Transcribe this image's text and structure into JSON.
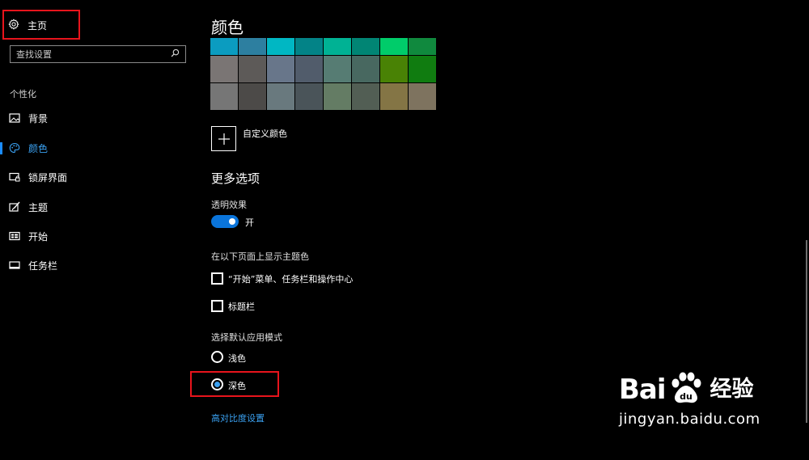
{
  "sidebar": {
    "home_label": "主页",
    "search_placeholder": "查找设置",
    "section_title": "个性化",
    "items": [
      {
        "label": "背景",
        "icon": "picture-icon"
      },
      {
        "label": "颜色",
        "icon": "palette-icon",
        "active": true
      },
      {
        "label": "锁屏界面",
        "icon": "lock-screen-icon"
      },
      {
        "label": "主题",
        "icon": "brush-icon"
      },
      {
        "label": "开始",
        "icon": "start-icon"
      },
      {
        "label": "任务栏",
        "icon": "taskbar-icon"
      }
    ]
  },
  "main": {
    "title": "颜色",
    "swatch_rows": [
      [
        "#0b9cc0",
        "#2d7fa0",
        "#00b7c3",
        "#038387",
        "#00b294",
        "#018574",
        "#00cc6a",
        "#10893e"
      ],
      [
        "#7a7574",
        "#5d5a58",
        "#68768a",
        "#515c6b",
        "#567c73",
        "#486860",
        "#498205",
        "#107c10"
      ],
      [
        "#767676",
        "#4c4a48",
        "#69797e",
        "#4a5459",
        "#647c64",
        "#525e54",
        "#847545",
        "#7e735f"
      ]
    ],
    "custom_color_label": "自定义颜色",
    "more_options_title": "更多选项",
    "transparency": {
      "label": "透明效果",
      "state_label": "开",
      "on": true
    },
    "accent_surfaces": {
      "label": "在以下页面上显示主题色",
      "options": [
        {
          "label": "“开始”菜单、任务栏和操作中心",
          "checked": false
        },
        {
          "label": "标题栏",
          "checked": false
        }
      ]
    },
    "app_mode": {
      "label": "选择默认应用模式",
      "options": [
        {
          "label": "浅色",
          "selected": false
        },
        {
          "label": "深色",
          "selected": true
        }
      ]
    },
    "high_contrast_link": "高对比度设置"
  },
  "watermark": {
    "brand_left": "Bai",
    "brand_right": "du",
    "brand_cn": "经验",
    "url": "jingyan.baidu.com"
  },
  "colors": {
    "accent": "#3aa0f0",
    "toggle_on": "#0a74da",
    "highlight_box": "#e8141c",
    "background": "#000000"
  }
}
